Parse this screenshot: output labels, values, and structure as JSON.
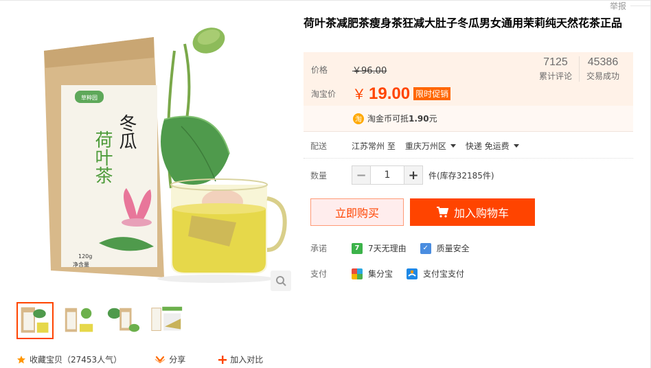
{
  "report_label": "举报",
  "product": {
    "title": "荷叶茶减肥茶瘦身茶狂减大肚子冬瓜男女通用茉莉纯天然花茶正品",
    "package_brand": "草粹园",
    "package_title": "冬瓜",
    "package_subtitle": "荷叶茶",
    "package_weight": "120g",
    "package_weight_label": "净含量"
  },
  "price": {
    "label": "价格",
    "old_value": "￥96.00",
    "taobao_label": "淘宝价",
    "currency": "￥",
    "now_value": "19.00",
    "promo_tag": "限时促销",
    "colors": {
      "accent": "#ff4400",
      "promo": "#ff6600",
      "box_bg": "#fff2e8"
    }
  },
  "stats": [
    {
      "num": "7125",
      "caption": "累计评论"
    },
    {
      "num": "45386",
      "caption": "交易成功"
    }
  ],
  "coin": {
    "icon": "淘",
    "prefix": "淘金币可抵",
    "amount": "1.90",
    "suffix": "元"
  },
  "delivery": {
    "label": "配送",
    "origin": "江苏常州 至",
    "destination": "重庆万州区",
    "method": "快递 免运费"
  },
  "quantity": {
    "label": "数量",
    "minus": "−",
    "value": "1",
    "plus": "+",
    "stock_text": "件(库存32185件)"
  },
  "actions": {
    "buy_now": "立即购买",
    "add_to_cart": "加入购物车"
  },
  "promise": {
    "label": "承诺",
    "items": [
      {
        "icon": "7",
        "text": "7天无理由"
      },
      {
        "icon": "✓",
        "text": "质量安全"
      }
    ]
  },
  "payment": {
    "label": "支付",
    "items": [
      {
        "icon": "jifenbao-icon",
        "text": "集分宝"
      },
      {
        "icon": "alipay-icon",
        "text": "支付宝支付"
      }
    ]
  },
  "social": {
    "favorite": "收藏宝贝（27453人气）",
    "share": "分享",
    "compare": "加入对比"
  }
}
